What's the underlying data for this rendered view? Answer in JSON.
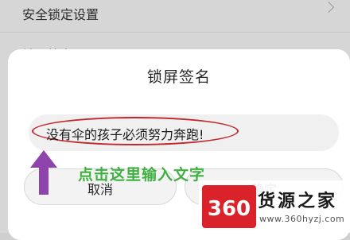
{
  "settings": {
    "rows": [
      {
        "label": "安全锁定设置"
      },
      {
        "label": "锁屏签名"
      }
    ]
  },
  "dialog": {
    "title": "锁屏签名",
    "input_value": "没有伞的孩子必须努力奔跑!",
    "cancel_label": "取消",
    "ok_label": "确定"
  },
  "annotation": {
    "hint": "点击这里输入文字",
    "arrow_color": "#8e44ad",
    "highlight_color": "#c0272d",
    "hint_color": "#3fb041"
  },
  "watermark": {
    "logo_text": "360",
    "title": "货源之家",
    "url": "www.360hyzj.com"
  }
}
